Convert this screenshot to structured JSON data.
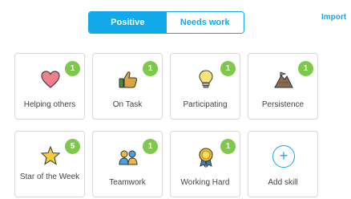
{
  "filter_toggle": {
    "positive_label": "Positive",
    "needs_work_label": "Needs work",
    "selected": "Positive"
  },
  "import_link": "Import",
  "skills": [
    {
      "label": "Helping others",
      "count": "1",
      "icon": "heart-icon"
    },
    {
      "label": "On Task",
      "count": "1",
      "icon": "thumbs-up-icon"
    },
    {
      "label": "Participating",
      "count": "1",
      "icon": "lightbulb-icon"
    },
    {
      "label": "Persistence",
      "count": "1",
      "icon": "climbing-mountain-icon"
    },
    {
      "label": "Star of the Week",
      "count": "5",
      "icon": "star-icon"
    },
    {
      "label": "Teamwork",
      "count": "1",
      "icon": "teamwork-icon"
    },
    {
      "label": "Working Hard",
      "count": "1",
      "icon": "medal-icon"
    }
  ],
  "add_skill": {
    "label": "Add skill",
    "icon": "plus-icon"
  },
  "colors": {
    "accent": "#13a9e8",
    "badge": "#7ec94a"
  }
}
